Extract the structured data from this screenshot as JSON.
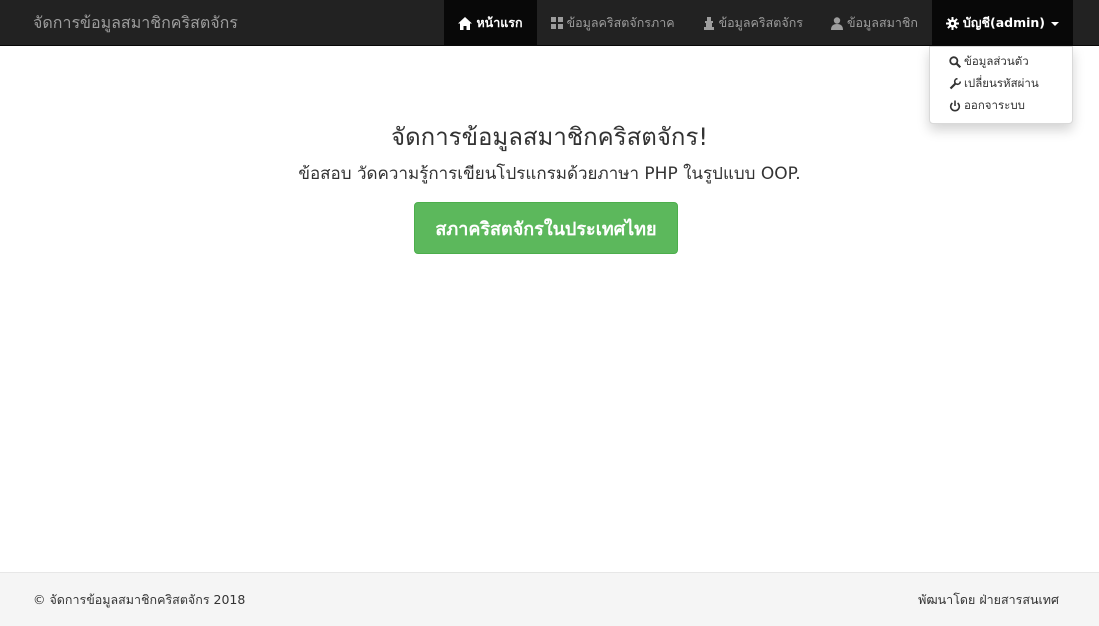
{
  "navbar": {
    "brand": "จัดการข้อมูลสมาชิกคริสตจักร",
    "items": [
      {
        "label": "หน้าแรก",
        "icon": "home-icon"
      },
      {
        "label": "ข้อมูลคริสตจักรภาค",
        "icon": "th-large-icon"
      },
      {
        "label": "ข้อมูลคริสตจักร",
        "icon": "chess-pawn-icon"
      },
      {
        "label": "ข้อมูลสมาชิก",
        "icon": "user-icon"
      },
      {
        "label": "บัญชี(admin)",
        "icon": "gear-icon"
      }
    ]
  },
  "dropdown": {
    "items": [
      {
        "label": "ข้อมูลส่วนตัว",
        "icon": "search-icon"
      },
      {
        "label": "เปลี่ยนรหัสผ่าน",
        "icon": "wrench-icon"
      },
      {
        "label": "ออกจาระบบ",
        "icon": "power-icon"
      }
    ]
  },
  "hero": {
    "title": "จัดการข้อมูลสมาชิกคริสตจักร!",
    "subtitle": "ข้อสอบ วัดความรู้การเขียนโปรแกรมด้วยภาษา PHP ในรูปแบบ OOP.",
    "button_label": "สภาคริสตจักรในประเทศไทย"
  },
  "footer": {
    "left": "© จัดการข้อมูลสมาชิกคริสตจักร 2018",
    "right": "พัฒนาโดย ฝ่ายสารสนเทศ"
  },
  "colors": {
    "navbar_bg": "#222222",
    "active_bg": "#080808",
    "button_green": "#5cb85c",
    "footer_bg": "#f5f5f5"
  }
}
